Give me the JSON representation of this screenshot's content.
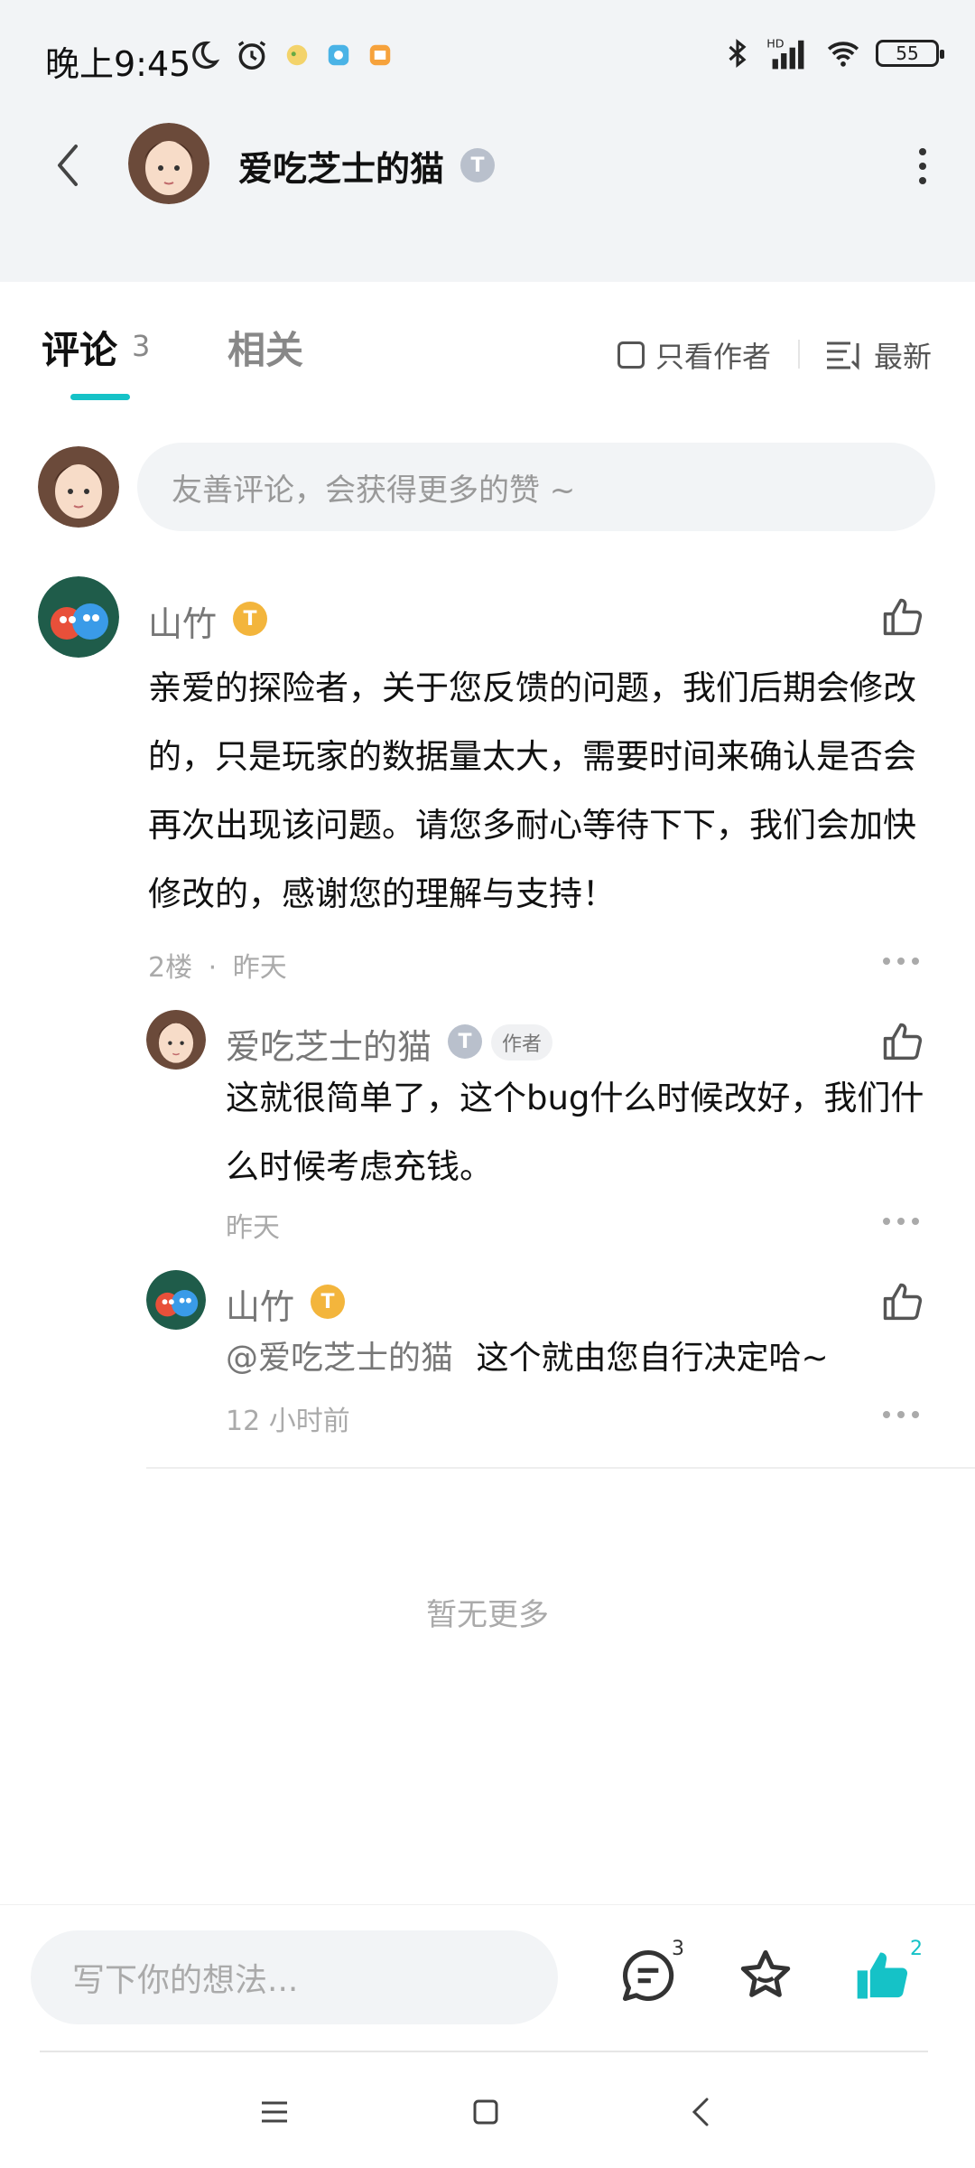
{
  "status_bar": {
    "time": "晚上9:45",
    "battery": "55"
  },
  "header": {
    "author_name": "爱吃芝士的猫",
    "badge_letter": "T"
  },
  "tabs": {
    "comments_label": "评论",
    "comments_count": "3",
    "related_label": "相关",
    "only_author_label": "只看作者",
    "sort_label": "最新"
  },
  "comment_input": {
    "placeholder": "友善评论，会获得更多的赞 ~"
  },
  "comments": [
    {
      "name": "山竹",
      "badge_letter": "T",
      "text": "亲爱的探险者，关于您反馈的问题，我们后期会修改的，只是玩家的数据量太大，需要时间来确认是否会再次出现该问题。请您多耐心等待下下，我们会加快修改的，感谢您的理解与支持！",
      "floor": "2楼",
      "sep": "·",
      "time": "昨天"
    }
  ],
  "replies": [
    {
      "name": "爱吃芝士的猫",
      "badge_letter": "T",
      "author_tag": "作者",
      "text": "这就很简单了，这个bug什么时候改好，我们什么时候考虑充钱。",
      "time": "昨天"
    },
    {
      "name": "山竹",
      "badge_letter": "T",
      "mention": "@爱吃芝士的猫",
      "text": "这个就由您自行决定哈~",
      "time": "12 小时前"
    }
  ],
  "footer": {
    "no_more": "暂无更多"
  },
  "bottom_bar": {
    "input_placeholder": "写下你的想法...",
    "comment_count": "3",
    "like_count": "2"
  },
  "colors": {
    "accent": "#15c2c7",
    "gold_badge": "#f3b53c",
    "silver_badge": "#b9c0cc"
  }
}
